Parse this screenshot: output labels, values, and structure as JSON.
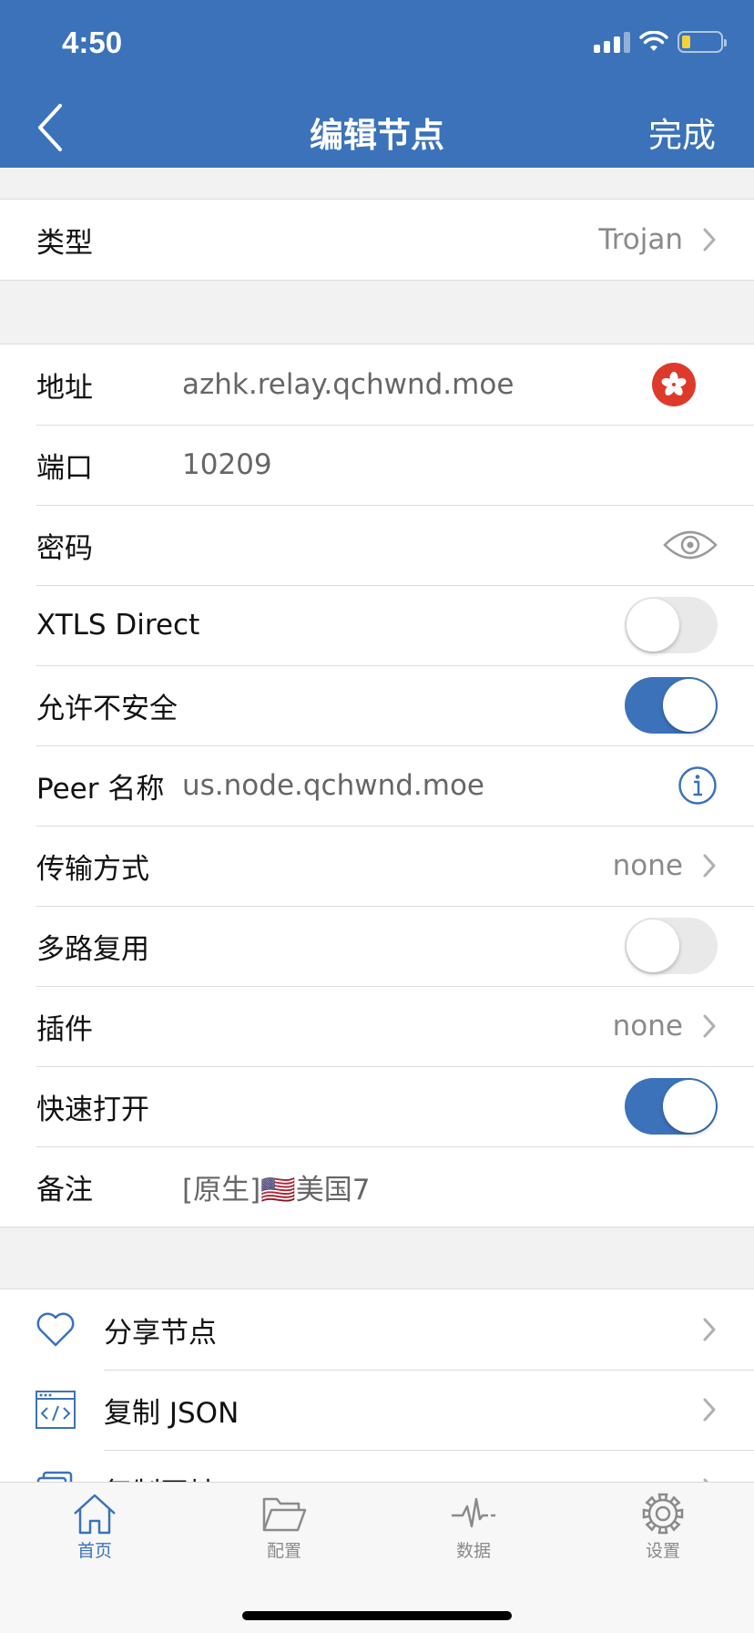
{
  "status_bar": {
    "time": "4:50"
  },
  "nav": {
    "title": "编辑节点",
    "done_label": "完成",
    "back_icon": "chevron-left-icon"
  },
  "type_row": {
    "label": "类型",
    "value": "Trojan"
  },
  "fields": {
    "address": {
      "label": "地址",
      "value": "azhk.relay.qchwnd.moe",
      "flag_icon": "hong-kong-flag-icon"
    },
    "port": {
      "label": "端口",
      "value": "10209"
    },
    "password": {
      "label": "密码",
      "value": ""
    },
    "xtls": {
      "label": "XTLS Direct",
      "on": false
    },
    "allow_insecure": {
      "label": "允许不安全",
      "on": true
    },
    "peer": {
      "label": "Peer 名称",
      "value": "us.node.qchwnd.moe"
    },
    "transport": {
      "label": "传输方式",
      "value": "none"
    },
    "mux": {
      "label": "多路复用",
      "on": false
    },
    "plugin": {
      "label": "插件",
      "value": "none"
    },
    "fast_open": {
      "label": "快速打开",
      "on": true
    },
    "remark": {
      "label": "备注",
      "value": "[原生]🇺🇸美国7"
    }
  },
  "actions": [
    {
      "label": "分享节点",
      "icon": "heart-icon"
    },
    {
      "label": "复制 JSON",
      "icon": "code-window-icon"
    },
    {
      "label": "复制网址",
      "icon": "copy-icon"
    }
  ],
  "tabs": [
    {
      "label": "首页",
      "icon": "home-icon",
      "active": true
    },
    {
      "label": "配置",
      "icon": "folder-icon",
      "active": false
    },
    {
      "label": "数据",
      "icon": "activity-icon",
      "active": false
    },
    {
      "label": "设置",
      "icon": "gear-icon",
      "active": false
    }
  ],
  "colors": {
    "accent": "#3b72b9",
    "background": "#f2f2f2",
    "flag_red": "#de3a2c"
  }
}
